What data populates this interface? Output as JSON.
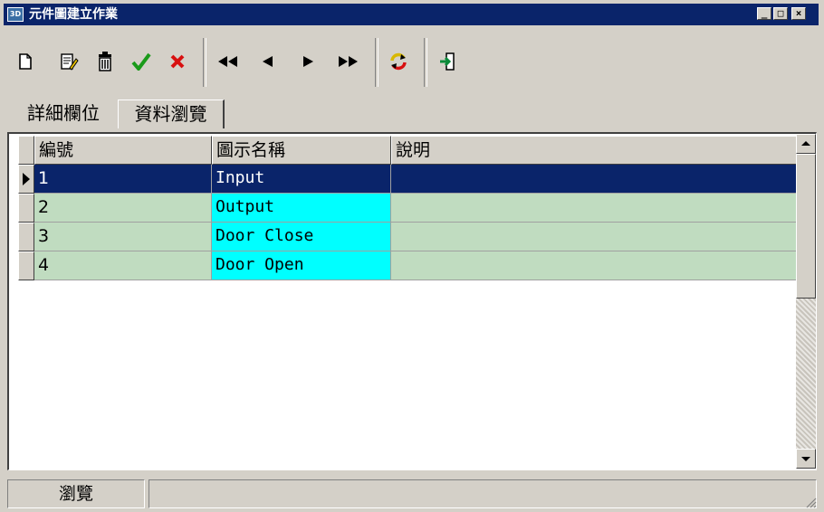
{
  "window": {
    "title": "元件圖建立作業",
    "app_icon_text": "3D",
    "controls": {
      "minimize": "_",
      "maximize": "□",
      "close": "×"
    }
  },
  "toolbar": {
    "buttons": [
      {
        "name": "new-icon",
        "label": ""
      },
      {
        "name": "edit-icon",
        "label": ""
      },
      {
        "name": "delete-icon",
        "label": ""
      },
      {
        "name": "confirm-icon",
        "label": ""
      },
      {
        "name": "cancel-icon",
        "label": ""
      },
      {
        "name": "first-record-icon",
        "label": ""
      },
      {
        "name": "previous-record-icon",
        "label": ""
      },
      {
        "name": "next-record-icon",
        "label": ""
      },
      {
        "name": "last-record-icon",
        "label": ""
      },
      {
        "name": "refresh-icon",
        "label": ""
      },
      {
        "name": "exit-icon",
        "label": ""
      }
    ],
    "colors": {
      "confirm": "#1a9a1a",
      "cancel": "#d81010",
      "refresh": "#d8b800",
      "exit": "#0b8a3a"
    }
  },
  "tabs": [
    {
      "label": "詳細欄位",
      "active": false
    },
    {
      "label": "資料瀏覽",
      "active": true
    }
  ],
  "grid": {
    "columns": [
      "編號",
      "圖示名稱",
      "說明"
    ],
    "rows": [
      {
        "id": "1",
        "name": "Input",
        "desc": "",
        "selected": true
      },
      {
        "id": "2",
        "name": "Output",
        "desc": "",
        "selected": false
      },
      {
        "id": "3",
        "name": "Door Close",
        "desc": "",
        "selected": false
      },
      {
        "id": "4",
        "name": "Door Open",
        "desc": "",
        "selected": false
      }
    ],
    "colors": {
      "selected_row": "#0a246a",
      "name_cell": "#00ffff",
      "row_bg": "#c0dcc0"
    }
  },
  "status": {
    "mode": "瀏覽",
    "message": ""
  }
}
